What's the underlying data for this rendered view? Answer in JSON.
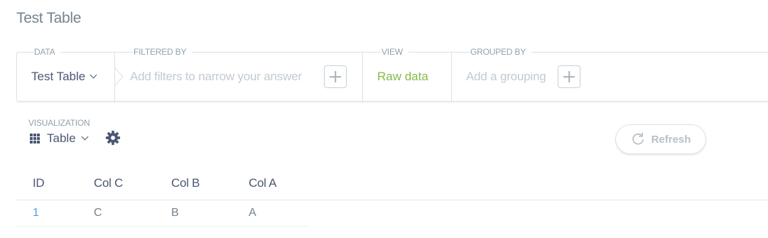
{
  "page": {
    "title": "Test Table"
  },
  "query_builder": {
    "data": {
      "label": "DATA",
      "value": "Test Table"
    },
    "filter": {
      "label": "FILTERED BY",
      "placeholder": "Add filters to narrow your answer"
    },
    "view": {
      "label": "VIEW",
      "value": "Raw data"
    },
    "group": {
      "label": "GROUPED BY",
      "placeholder": "Add a grouping"
    }
  },
  "visualization": {
    "label": "VISUALIZATION",
    "selected": "Table",
    "icon": "table-grid-icon",
    "settings_icon": "gear-icon"
  },
  "refresh": {
    "label": "Refresh",
    "icon": "refresh-icon"
  },
  "table": {
    "columns": [
      "ID",
      "Col C",
      "Col B",
      "Col A"
    ],
    "rows": [
      [
        "1",
        "C",
        "B",
        "A"
      ]
    ]
  },
  "colors": {
    "accent_green": "#84bb4c",
    "link_blue": "#509ee3",
    "text_dark": "#4c5773",
    "text_muted": "#74838f",
    "border": "#dce1e4"
  }
}
